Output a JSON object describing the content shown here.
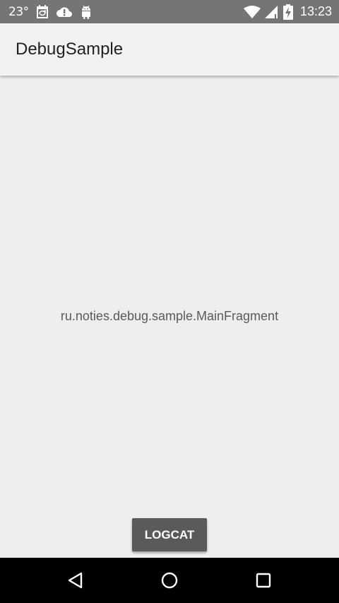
{
  "status_bar": {
    "temperature": "23°",
    "time": "13:23",
    "icons": [
      "calendar-icon",
      "cloud-alert-icon",
      "android-icon",
      "wifi-icon",
      "signal-icon",
      "battery-charging-icon"
    ]
  },
  "app_bar": {
    "title": "DebugSample"
  },
  "main": {
    "fragment_label": "ru.noties.debug.sample.MainFragment",
    "logcat_button_label": "LOGCAT"
  },
  "nav_bar": {
    "buttons": [
      "back-icon",
      "home-icon",
      "recents-icon"
    ]
  },
  "colors": {
    "status_bar": "#757575",
    "app_bar": "#f2f2f2",
    "background": "#eeeeee",
    "button": "#5a5a5a",
    "nav_bar": "#000000"
  }
}
